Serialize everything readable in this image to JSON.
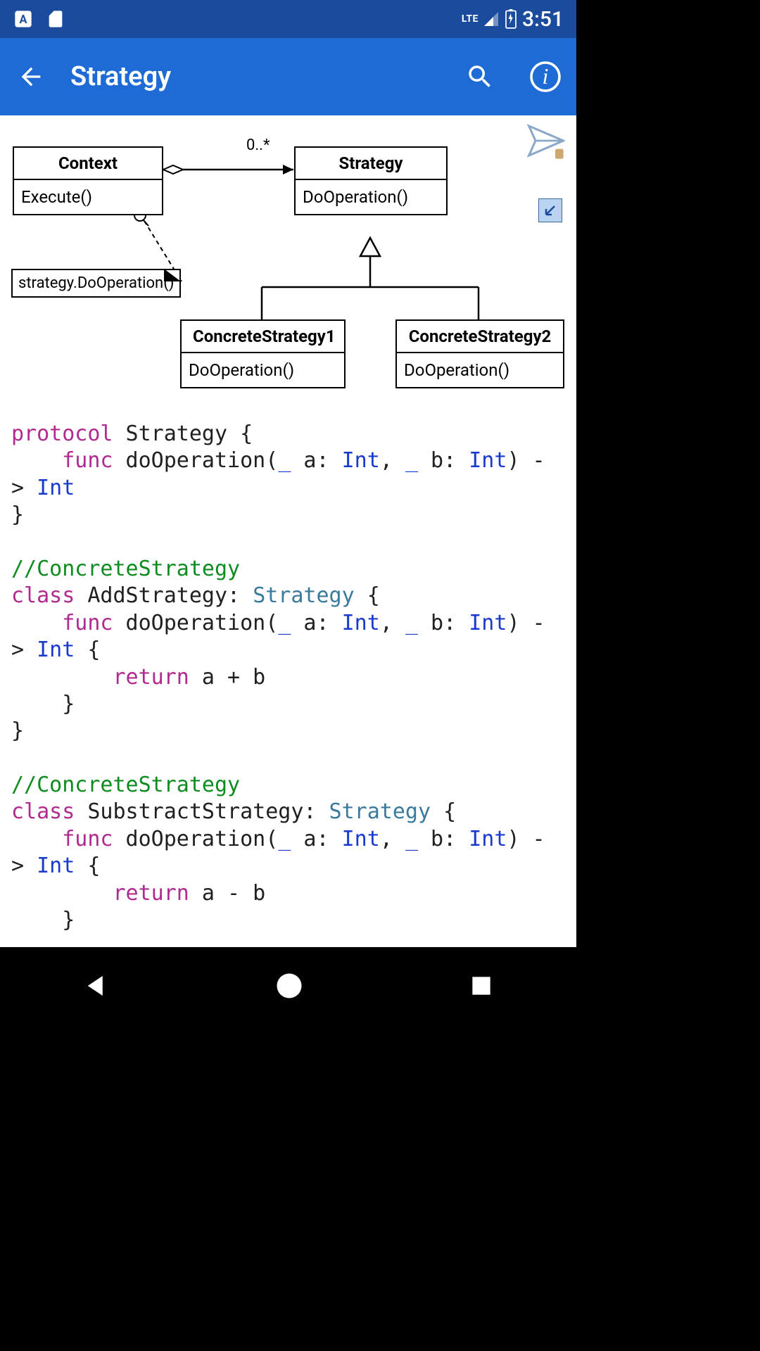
{
  "status": {
    "lte": "LTE",
    "time": "3:51"
  },
  "appbar": {
    "title": "Strategy"
  },
  "diagram": {
    "context": {
      "title": "Context",
      "method": "Execute()"
    },
    "strategy": {
      "title": "Strategy",
      "method": "DoOperation()"
    },
    "concrete1": {
      "title": "ConcreteStrategy1",
      "method": "DoOperation()"
    },
    "concrete2": {
      "title": "ConcreteStrategy2",
      "method": "DoOperation()"
    },
    "multiplicity": "0..*",
    "note": "strategy.DoOperation()"
  },
  "code": {
    "l1_protocol": "protocol",
    "l1_name": " Strategy {",
    "l2_func": "func",
    "l2_sig": " doOperation(",
    "l2_score": "_",
    "l2_a": " a: ",
    "l2_int": "Int",
    "l2_comma": ", ",
    "l2_score2": "_",
    "l2_b": " b: ",
    "l2_int2": "Int",
    "l2_arrow_part": ") -",
    "l3_gt": "> ",
    "l3_int": "Int",
    "l4": "}",
    "comment1": "//ConcreteStrategy",
    "l6_class": "class",
    "l6_name": " AddStrategy: ",
    "l6_type": "Strategy",
    "l6_brace": " {",
    "l10_return": "return",
    "l10_expr": " a + b",
    "l11": "    }",
    "l12": "}",
    "comment2": "//ConcreteStrategy",
    "l14_class": "class",
    "l14_name": " SubstractStrategy: ",
    "l14_type": "Strategy",
    "l14_brace": " {",
    "l18_return": "return",
    "l18_expr": " a - b",
    "l19": "    }"
  }
}
